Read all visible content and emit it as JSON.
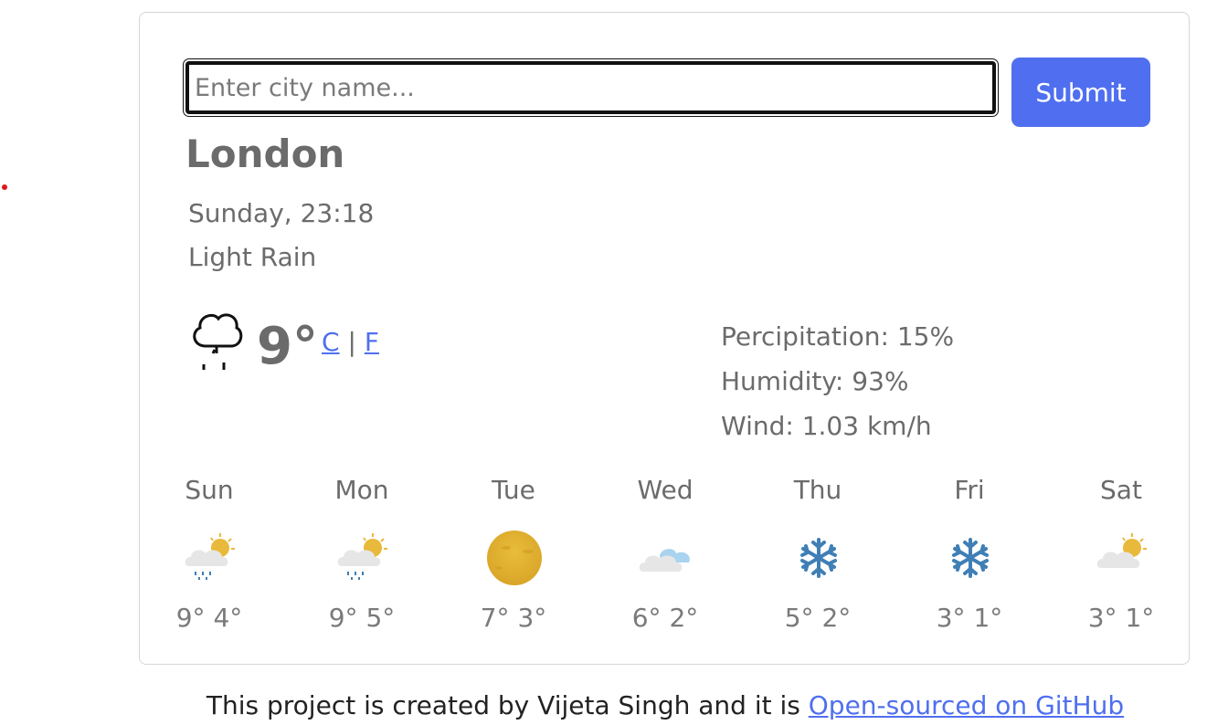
{
  "search": {
    "placeholder": "Enter city name...",
    "value": ""
  },
  "submit_label": "Submit",
  "current": {
    "city": "London",
    "datetime": "Sunday, 23:18",
    "condition": "Light Rain",
    "temperature": "9°",
    "unit_c": "C",
    "unit_separator": "|",
    "unit_f": "F",
    "icon": "cloud-rain-outline-icon",
    "precipitation": "Percipitation: 15%",
    "humidity": "Humidity: 93%",
    "wind": "Wind: 1.03 km/h"
  },
  "forecast": [
    {
      "day": "Sun",
      "temps": "9° 4°",
      "icon": "cloud-sun-rain-icon"
    },
    {
      "day": "Mon",
      "temps": "9° 5°",
      "icon": "cloud-sun-rain-icon"
    },
    {
      "day": "Tue",
      "temps": "7° 3°",
      "icon": "sun-icon"
    },
    {
      "day": "Wed",
      "temps": "6° 2°",
      "icon": "cloud-icon"
    },
    {
      "day": "Thu",
      "temps": "5° 2°",
      "icon": "snowflake-icon"
    },
    {
      "day": "Fri",
      "temps": "3° 1°",
      "icon": "snowflake-icon"
    },
    {
      "day": "Sat",
      "temps": "3° 1°",
      "icon": "cloud-sun-icon"
    }
  ],
  "footer": {
    "text": "This project is created by Vijeta Singh and it is",
    "link_label": "Open-sourced on GitHub"
  },
  "colors": {
    "accent": "#4f6ff0",
    "text": "#6b6b6b",
    "border": "#d6d6d6",
    "sun": "#e8b93a",
    "snowflake": "#3f7fb5"
  }
}
